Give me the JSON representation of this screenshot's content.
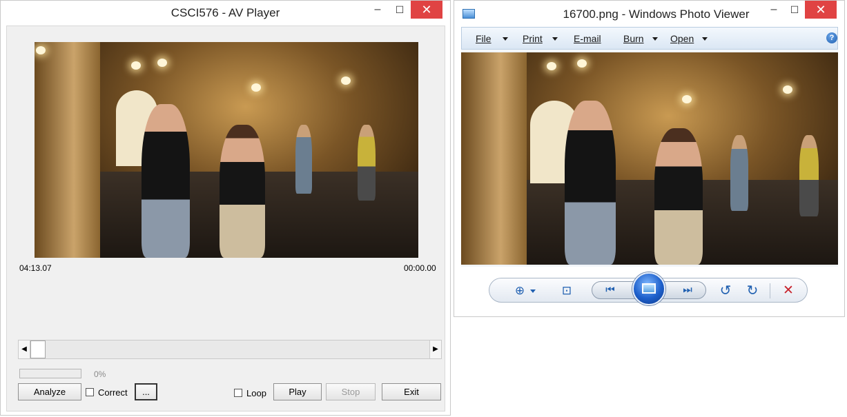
{
  "av_player": {
    "title": "CSCI576 - AV Player",
    "window_controls": {
      "minimize": "‒",
      "maximize": "☐",
      "close": "✕"
    },
    "time_left": "04:13.07",
    "time_right": "00:00.00",
    "scroll_left": "◀",
    "scroll_right": "▶",
    "progress_percent": 0,
    "progress_text": "0%",
    "buttons": {
      "analyze": "Analyze",
      "browse": "...",
      "play": "Play",
      "stop": "Stop",
      "exit": "Exit"
    },
    "checkboxes": {
      "correct": {
        "label": "Correct",
        "checked": false
      },
      "loop": {
        "label": "Loop",
        "checked": false
      }
    }
  },
  "photo_viewer": {
    "title": "16700.png - Windows Photo Viewer",
    "window_controls": {
      "minimize": "‒",
      "maximize": "☐",
      "close": "✕"
    },
    "menu": [
      "File",
      "Print",
      "E-mail",
      "Burn",
      "Open"
    ],
    "help": "?",
    "toolbar_icons": {
      "zoom": "⊕",
      "fit": "⊡",
      "previous": "⏮",
      "next": "⏭",
      "rotate_ccw": "↺",
      "rotate_cw": "↻",
      "delete": "✕"
    }
  },
  "colors": {
    "close_red": "#e04343",
    "accent_blue": "#1f5fb0",
    "delete_red": "#c8232c"
  }
}
